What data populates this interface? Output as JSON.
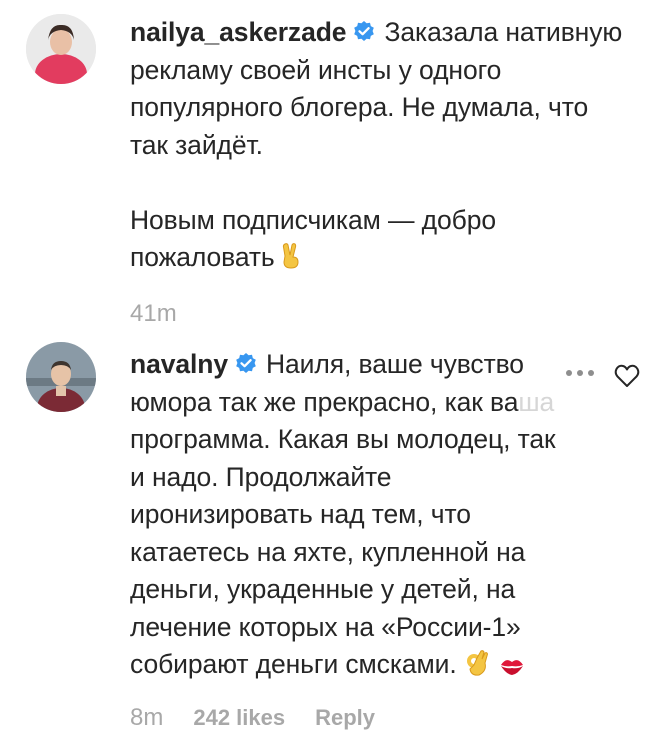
{
  "comments": [
    {
      "username": "nailya_askerzade",
      "text_lines": [
        "Заказала нативную",
        "рекламу своей инсты у одного",
        "популярного блогера. Не думала, что",
        "так зайдёт.",
        "",
        "Новым подписчикам — добро",
        "пожаловать"
      ],
      "emoji": "victory-hand",
      "time": "41m"
    },
    {
      "username": "navalny",
      "text_lines": [
        "Наиля, ваше чувство",
        "юмора так же прекрасно, как ва",
        "программа. Какая вы молодец, так",
        "и надо. Продолжайте",
        "иронизировать над тем, что",
        "катаетесь на яхте, купленной на",
        "деньги, украденные у детей, на",
        "лечение которых на «России-1»",
        "собирают деньги смсками."
      ],
      "faded_tail": "ша",
      "emoji_1": "ok-hand",
      "emoji_2": "kiss-mark",
      "time": "8m",
      "likes": "242 likes",
      "reply": "Reply"
    }
  ],
  "colors": {
    "text": "#262626",
    "meta": "#a8a8a8",
    "verified": "#3897f0"
  }
}
